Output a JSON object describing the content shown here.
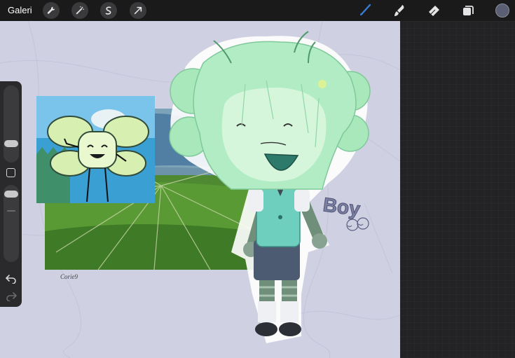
{
  "topbar": {
    "gallery_label": "Galeri",
    "left_tools": [
      "wrench-icon",
      "magic-wand-icon",
      "selection-icon",
      "transform-arrow-icon"
    ],
    "right_tools": [
      "brush-icon",
      "smudge-icon",
      "eraser-icon",
      "layers-icon"
    ],
    "active_tool": "brush-icon",
    "accent_color": "#3a7bd5",
    "current_color": "#5b5f73"
  },
  "sidebar": {
    "tools": [
      "brush-size-slider",
      "modify-button",
      "opacity-slider",
      "undo-icon",
      "redo-icon"
    ],
    "brush_size_level": 0.68,
    "opacity_level": 0.45
  },
  "artwork": {
    "signature": "Corie9",
    "handwritten_text": "Boy",
    "palette": {
      "hair": "#a8e8bb",
      "shirt": "#6fcfbf",
      "shorts": "#4c5a72",
      "stripes": "#6f8f7a",
      "sky": "#3aa0d4",
      "grass": "#4f8a33"
    }
  }
}
